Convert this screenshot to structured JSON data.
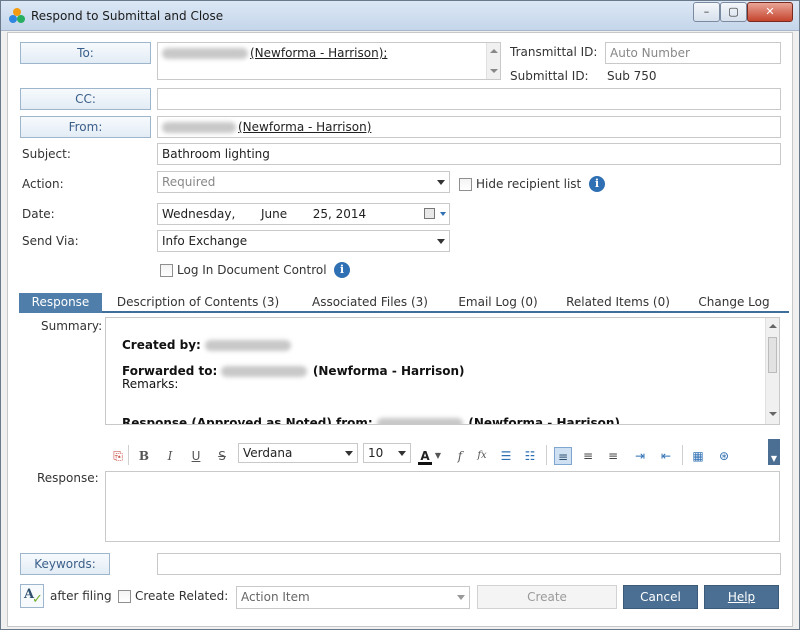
{
  "window": {
    "title": "Respond to Submittal and Close",
    "controls": {
      "minimize": "–",
      "maximize": "▢",
      "close": "✕"
    }
  },
  "to": {
    "label": "To:",
    "recipient_org": "(Newforma - Harrison);"
  },
  "transmittal": {
    "label": "Transmittal ID:",
    "placeholder": "Auto Number"
  },
  "submittal": {
    "label": "Submittal ID:",
    "value": "Sub 750"
  },
  "cc": {
    "label": "CC:",
    "value": ""
  },
  "from": {
    "label": "From:",
    "org": "(Newforma - Harrison)"
  },
  "subject": {
    "label": "Subject:",
    "value": "Bathroom lighting"
  },
  "action": {
    "label": "Action:",
    "placeholder": "Required"
  },
  "hide_recipient": {
    "label": "Hide recipient list"
  },
  "date": {
    "label": "Date:",
    "weekday": "Wednesday,",
    "month": "June",
    "day_year": "25, 2014"
  },
  "send_via": {
    "label": "Send Via:",
    "value": "Info Exchange"
  },
  "log_in_doc": {
    "label": "Log In Document Control"
  },
  "tabs": [
    {
      "label": "Response"
    },
    {
      "label": "Description of Contents (3)"
    },
    {
      "label": "Associated Files (3)"
    },
    {
      "label": "Email Log (0)"
    },
    {
      "label": "Related Items (0)"
    },
    {
      "label": "Change Log"
    }
  ],
  "summary": {
    "label": "Summary:",
    "created_by": "Created by:",
    "forwarded_to": "Forwarded to:",
    "forwarded_org": "(Newforma - Harrison)",
    "remarks": "Remarks:",
    "response_line": "Response (Approved as Noted) from:",
    "response_org": "(Newforma - Harrison)"
  },
  "toolbar": {
    "bold": "B",
    "italic": "I",
    "underline": "U",
    "strike": "S",
    "font": "Verdana",
    "size": "10",
    "font_color": "A",
    "func": "f",
    "fx": "fx"
  },
  "response": {
    "label": "Response:",
    "value": ""
  },
  "keywords": {
    "label": "Keywords:",
    "value": ""
  },
  "after_filing": {
    "label": "after filing"
  },
  "create_related": {
    "label": "Create Related:",
    "value": "Action Item"
  },
  "buttons": {
    "create": "Create",
    "cancel": "Cancel",
    "help": "Help"
  },
  "colors": {
    "accent": "#4f7eaa",
    "button_blue": "#4a6f92",
    "label_text": "#3a5f8a"
  }
}
